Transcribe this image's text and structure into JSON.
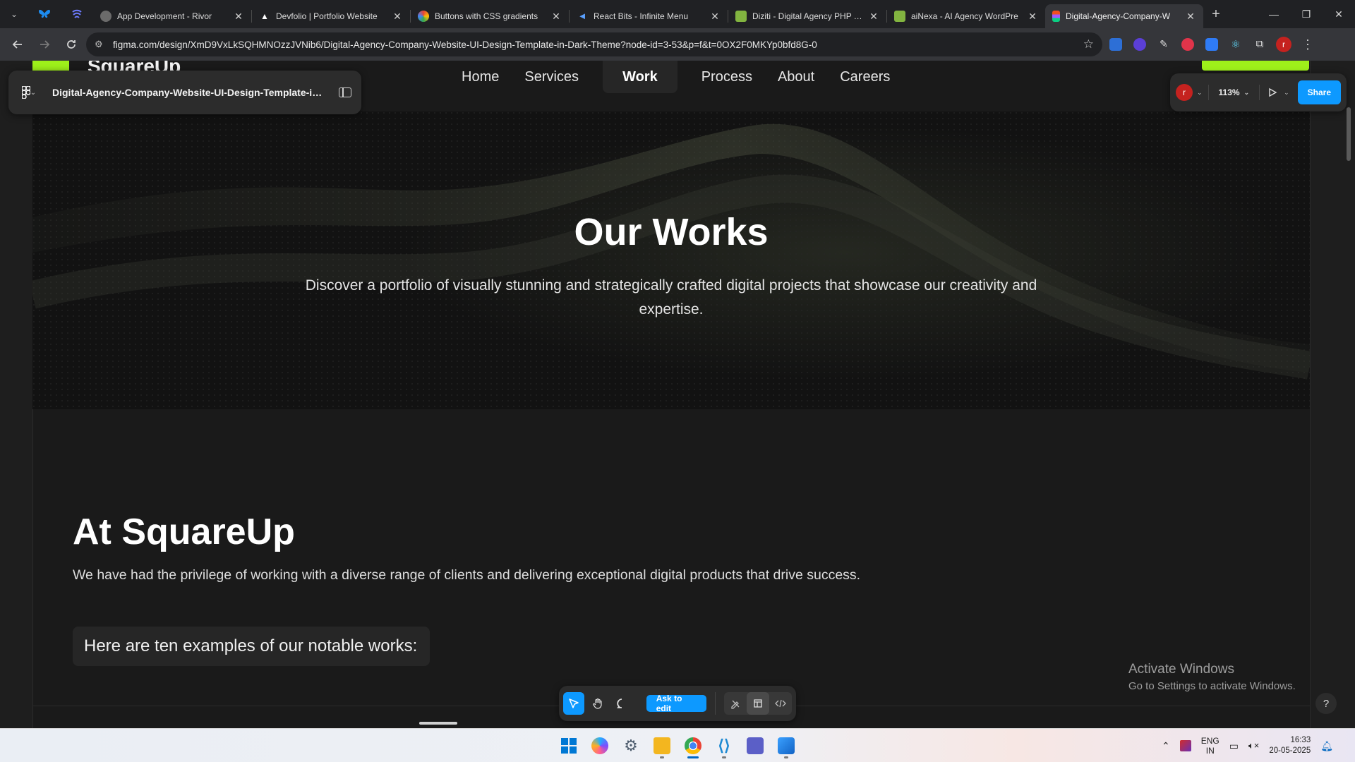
{
  "browser": {
    "tabs": [
      {
        "title": "App Development - Rivor",
        "active": false,
        "favicon_color": "#6b6b6b"
      },
      {
        "title": "Devfolio | Portfolio Website",
        "active": false,
        "favicon_color": "#ffffff"
      },
      {
        "title": "Buttons with CSS gradients",
        "active": false,
        "favicon_color": "#e8a23a"
      },
      {
        "title": "React Bits - Infinite Menu",
        "active": false,
        "favicon_color": "#5227ff"
      },
      {
        "title": "Diziti - Digital Agency PHP Te",
        "active": false,
        "favicon_color": "#82b440"
      },
      {
        "title": "aiNexa - AI Agency WordPre",
        "active": false,
        "favicon_color": "#82b440"
      },
      {
        "title": "Digital-Agency-Company-W",
        "active": true,
        "favicon_color": "#f24e1e"
      }
    ],
    "url": "figma.com/design/XmD9VxLkSQHMNOzzJVNib6/Digital-Agency-Company-Website-UI-Design-Template-in-Dark-Theme?node-id=3-53&p=f&t=0OX2F0MKYp0bfd8G-0",
    "profile_initial": "r"
  },
  "figma": {
    "file_name": "Digital-Agency-Company-Website-UI-Design-Template-in-...",
    "avatar_initial": "r",
    "zoom": "113%",
    "share_label": "Share",
    "ask_label": "Ask to edit",
    "help_label": "?"
  },
  "site": {
    "brand": "SquareUp",
    "nav": [
      "Home",
      "Services",
      "Work",
      "Process",
      "About",
      "Careers"
    ],
    "active_nav": "Work",
    "hero_title": "Our Works",
    "hero_subtitle": "Discover a portfolio of visually stunning and strategically crafted digital projects that showcase our creativity and expertise.",
    "section_title": "At SquareUp",
    "section_text": "We have had the privilege of working with a diverse range of clients and delivering exceptional digital products that drive success.",
    "section_chip": "Here are ten examples of our notable works:",
    "accent": "#9ef01a"
  },
  "watermark": {
    "line1": "Activate Windows",
    "line2": "Go to Settings to activate Windows."
  },
  "taskbar": {
    "lang_top": "ENG",
    "lang_bottom": "IN",
    "time": "16:33",
    "date": "20-05-2025"
  }
}
